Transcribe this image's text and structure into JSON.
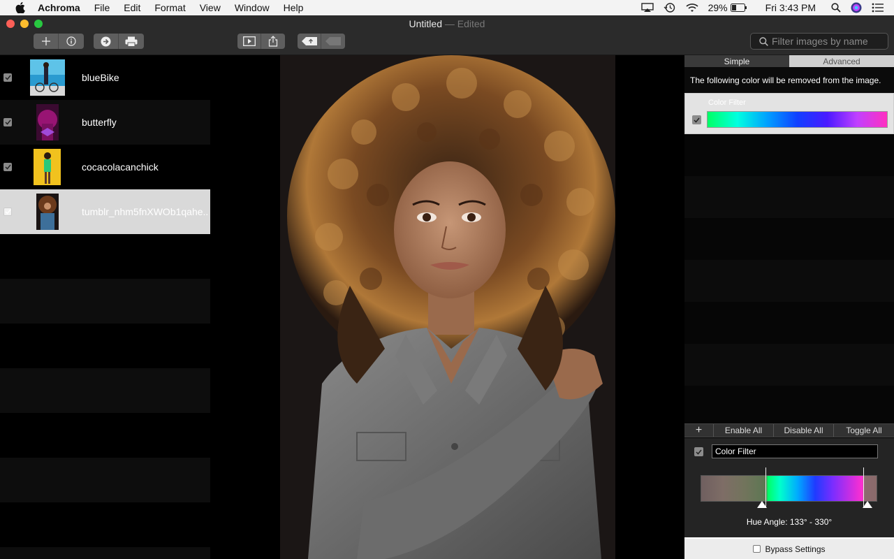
{
  "menubar": {
    "app_name": "Achroma",
    "items": [
      "File",
      "Edit",
      "Format",
      "View",
      "Window",
      "Help"
    ],
    "battery": "29%",
    "clock": "Fri 3:43 PM"
  },
  "window": {
    "title": "Untitled",
    "subtitle": "— Edited"
  },
  "search": {
    "placeholder": "Filter images by name"
  },
  "images": [
    {
      "name": "blueBike",
      "checked": true,
      "selected": false
    },
    {
      "name": "butterfly",
      "checked": true,
      "selected": false
    },
    {
      "name": "cocacolacanchick",
      "checked": true,
      "selected": false
    },
    {
      "name": "tumblr_nhm5fnXWOb1qahe...",
      "checked": true,
      "selected": true
    }
  ],
  "panel": {
    "tabs": [
      "Simple",
      "Advanced"
    ],
    "active_tab": "Simple",
    "description": "The following color will be removed from the image.",
    "filter_card_title": "Color Filter",
    "actions": {
      "add": "+",
      "enable_all": "Enable All",
      "disable_all": "Disable All",
      "toggle_all": "Toggle All"
    },
    "editor": {
      "name_value": "Color Filter",
      "hue_label": "Hue Angle:  133° - 330°",
      "hue_start_deg": 133,
      "hue_end_deg": 330
    },
    "bypass_label": "Bypass Settings"
  },
  "colors": {
    "accent_green": "#00ff66",
    "accent_magenta": "#ff30c0",
    "selected_row": "#d9d9d9"
  }
}
